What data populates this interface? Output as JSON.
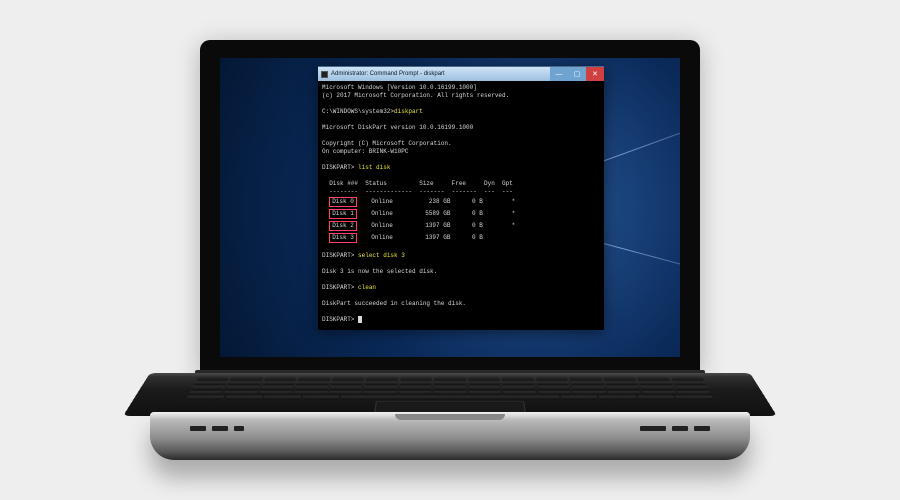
{
  "cmd": {
    "title": "Administrator: Command Prompt - diskpart",
    "buttons": {
      "min": "—",
      "max": "▢",
      "close": "✕"
    },
    "banner1": "Microsoft Windows [Version 10.0.16199.1000]",
    "banner2": "(c) 2017 Microsoft Corporation. All rights reserved.",
    "prompt_path": "C:\\WINDOWS\\system32>",
    "cmd_diskpart": "diskpart",
    "dp_version": "Microsoft DiskPart version 10.0.16199.1000",
    "dp_copyright": "Copyright (C) Microsoft Corporation.",
    "dp_computer": "On computer: BRINK-W10PC",
    "dp_prompt": "DISKPART>",
    "cmd_list": "list disk",
    "table": {
      "header": "  Disk ###  Status         Size     Free     Dyn  Gpt",
      "divider": "  --------  -------------  -------  -------  ---  ---",
      "rows": [
        {
          "label": "Disk 0",
          "rest": "    Online          238 GB      0 B        *"
        },
        {
          "label": "Disk 1",
          "rest": "    Online         5589 GB      0 B        *"
        },
        {
          "label": "Disk 2",
          "rest": "    Online         1397 GB      0 B        *"
        },
        {
          "label": "Disk 3",
          "rest": "    Online         1397 GB      0 B"
        }
      ]
    },
    "cmd_select": "select disk 3",
    "msg_selected": "Disk 3 is now the selected disk.",
    "cmd_clean": "clean",
    "msg_clean": "DiskPart succeeded in cleaning the disk."
  }
}
